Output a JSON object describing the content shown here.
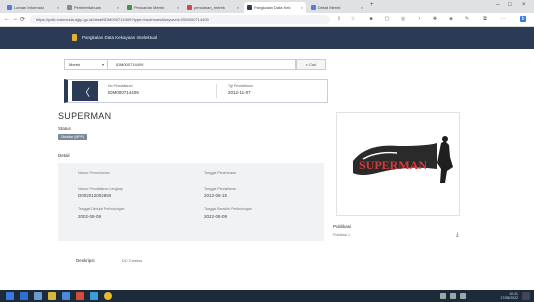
{
  "browser": {
    "tabs": [
      {
        "label": "Laman Informasi",
        "color": "#5a7bd8",
        "active": false
      },
      {
        "label": "Pemberitahuan",
        "color": "#8a8a8a",
        "active": false
      },
      {
        "label": "Pencarian Merek",
        "color": "#4a8c4a",
        "active": false
      },
      {
        "label": "pencarian_merek",
        "color": "#d04848",
        "active": false
      },
      {
        "label": "Pangkalan Data Kek",
        "color": "#2b3a55",
        "active": true
      },
      {
        "label": "Detail Merek",
        "color": "#5a7bd8",
        "active": false
      }
    ],
    "url": "https://pdki-indonesia.dgip.go.id/detail/IDM000714409?type=trademark&keyword=IDM000714409"
  },
  "app": {
    "title": "Pangkalan Data Kekayaan Intelektual"
  },
  "search": {
    "type": "Merek",
    "query": "IDM000714409",
    "button": "Cari"
  },
  "summary": {
    "col1_label": "No Pendaftaran",
    "col1_value": "IDM000714409",
    "col2_label": "Tgl Pendaftaran",
    "col2_value": "2012-11-07"
  },
  "detail": {
    "name": "SUPERMAN",
    "status_label": "Status",
    "status_badge": "Didaftar (MPP)",
    "section_label": "Detail",
    "fields": [
      {
        "label": "Nomor Permohonan",
        "value": ""
      },
      {
        "label": "Tanggal Penerimaan",
        "value": ""
      },
      {
        "label": "Nomor Pendaftaran Lengkap",
        "value": "D002012002850"
      },
      {
        "label": "Tanggal Pendaftaran",
        "value": "2012-06-15"
      },
      {
        "label": "Tanggal Dimulai Perlindungan",
        "value": "2002-08-09"
      },
      {
        "label": "Tanggal Berakhir Perlindungan",
        "value": "2022-08-09"
      }
    ]
  },
  "sidebar": {
    "label": "Publikasi",
    "value": "Publikasi 1"
  },
  "footer_row": {
    "label": "Deskripsi",
    "value": "DC Comics"
  },
  "logo_image": {
    "text": "SUPERMAN"
  },
  "taskbar": {
    "time": "10:31",
    "date": "17/08/2022",
    "icons": [
      "start-icon",
      "search-icon",
      "task-view-icon",
      "file-explorer-icon",
      "store-icon",
      "mail-icon",
      "edge-icon",
      "chrome-icon"
    ]
  }
}
